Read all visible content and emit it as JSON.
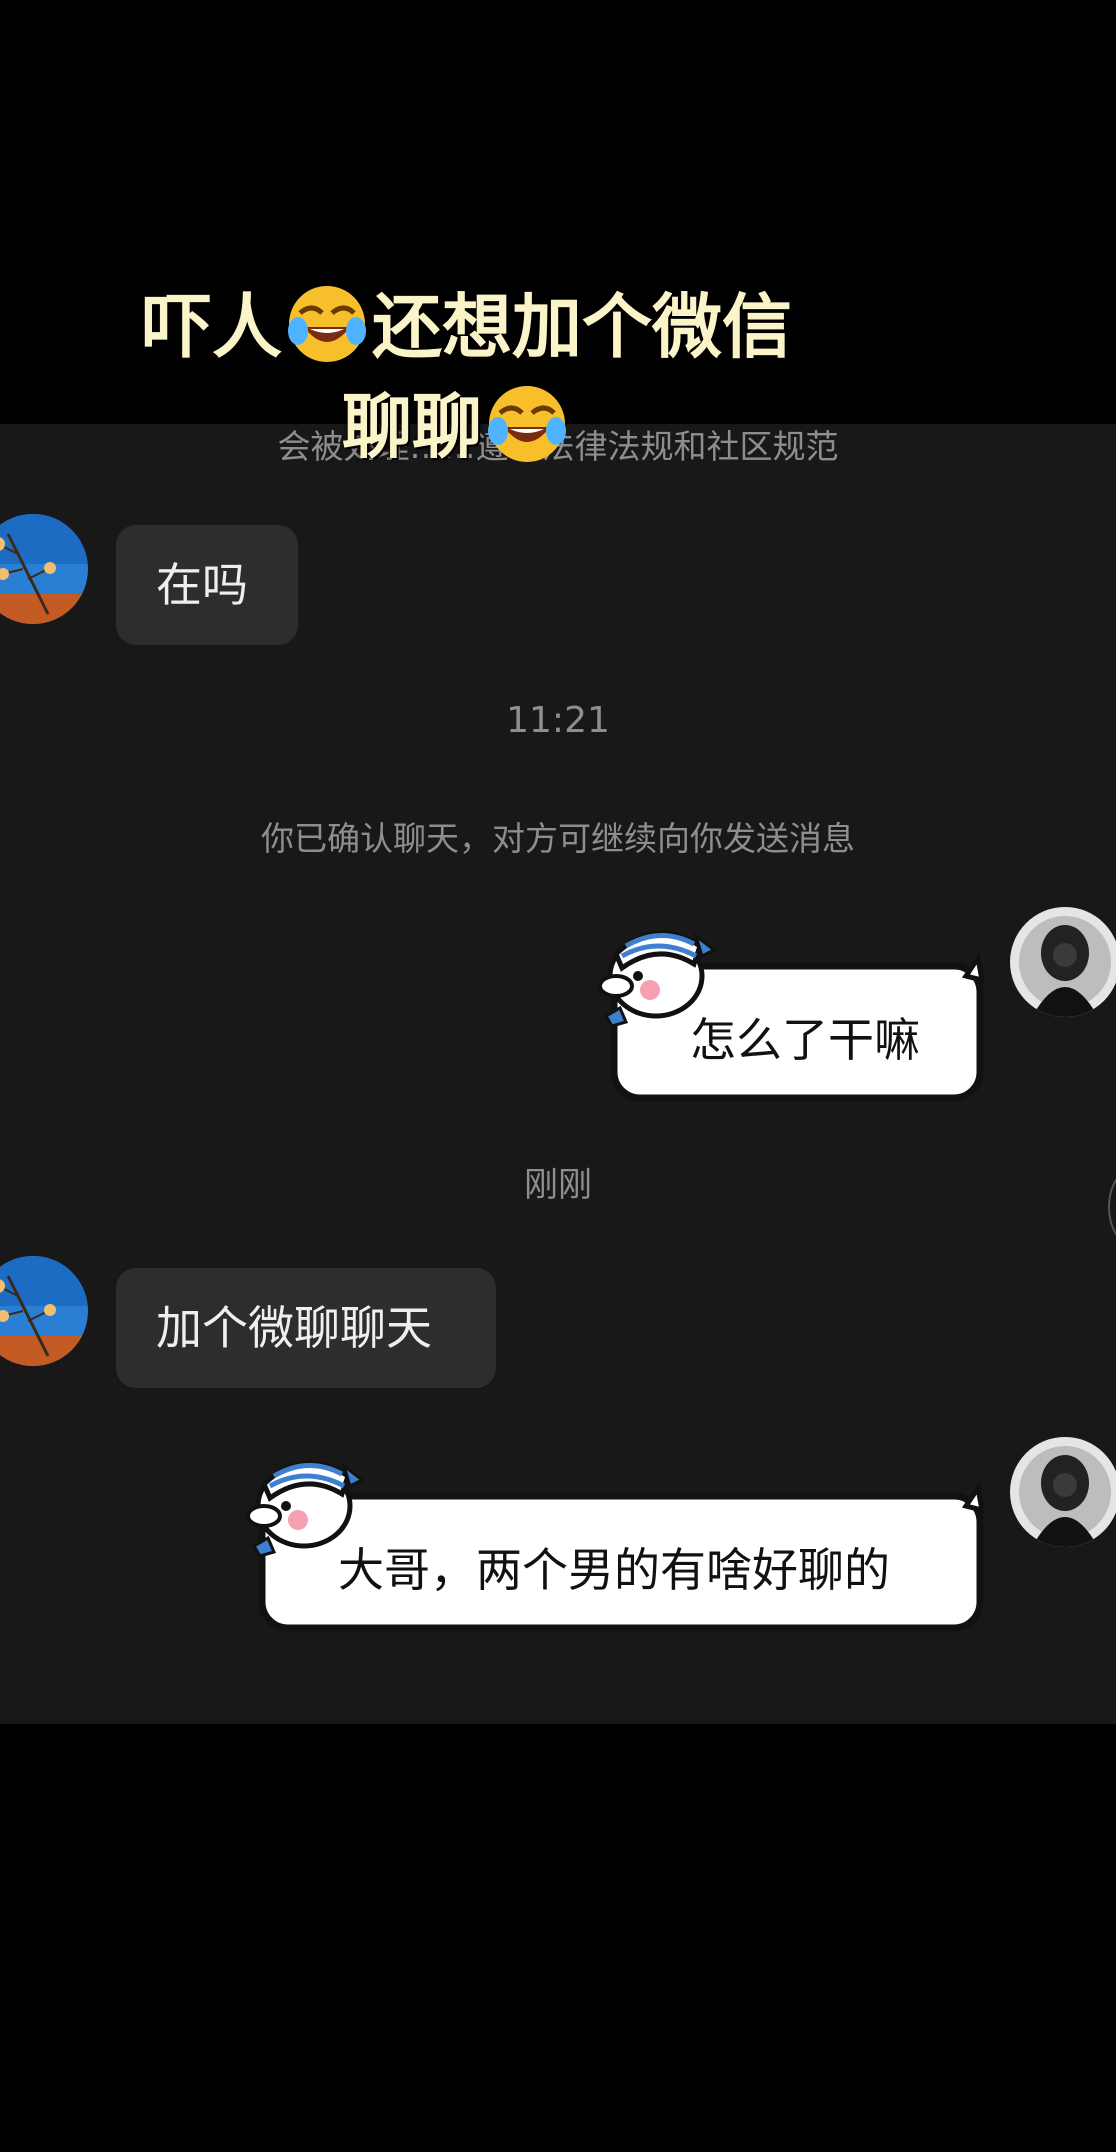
{
  "caption": {
    "line1_part1": "吓人",
    "line1_part2": "还想加个微信",
    "line2": "聊聊",
    "emoji_icon": "face-with-tears-of-joy-icon"
  },
  "system": {
    "top_notice": "会被处理……遵守法律法规和社区规范",
    "time_1": "11:21",
    "confirm_notice": "你已确认聊天，对方可继续向你发送消息",
    "time_2": "刚刚"
  },
  "messages": [
    {
      "side": "left",
      "text": "在吗"
    },
    {
      "side": "right",
      "text": "怎么了干嘛"
    },
    {
      "side": "left",
      "text": "加个微聊聊天"
    },
    {
      "side": "right",
      "text": "大哥，两个男的有啥好聊的"
    }
  ],
  "colors": {
    "background": "#000000",
    "chat_panel": "#181818",
    "incoming_bubble": "#2d2d2d",
    "caption_text": "#fbf4c9",
    "system_text": "#8e8e8e"
  }
}
